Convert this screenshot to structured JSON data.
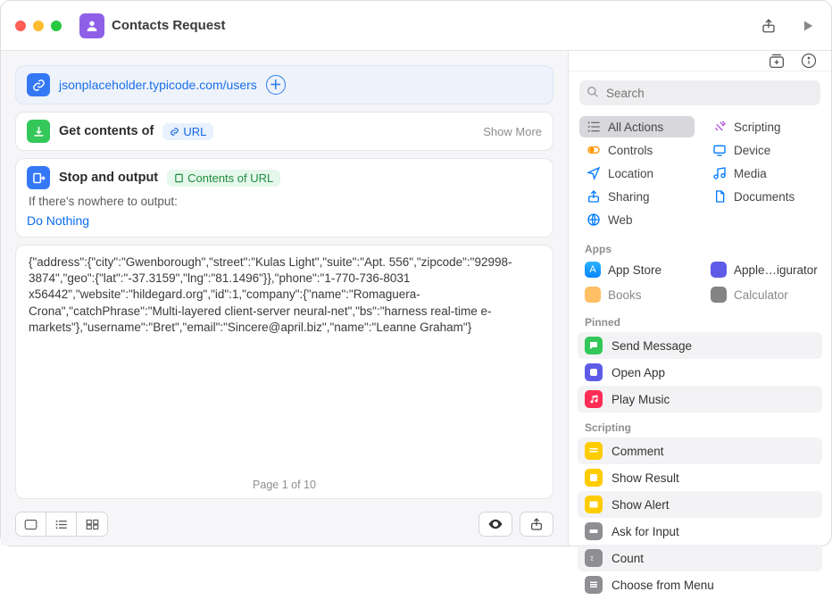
{
  "window": {
    "title": "Contacts Request"
  },
  "urlAction": {
    "url": "jsonplaceholder.typicode.com/users"
  },
  "getContents": {
    "title": "Get contents of",
    "token": "URL",
    "showMore": "Show More"
  },
  "stopOutput": {
    "title": "Stop and output",
    "token": "Contents of URL",
    "subLabel": "If there's nowhere to output:",
    "choice": "Do Nothing"
  },
  "output": {
    "text": "{\"address\":{\"city\":\"Gwenborough\",\"street\":\"Kulas Light\",\"suite\":\"Apt. 556\",\"zipcode\":\"92998-3874\",\"geo\":{\"lat\":\"-37.3159\",\"lng\":\"81.1496\"}},\"phone\":\"1-770-736-8031 x56442\",\"website\":\"hildegard.org\",\"id\":1,\"company\":{\"name\":\"Romaguera-Crona\",\"catchPhrase\":\"Multi-layered client-server neural-net\",\"bs\":\"harness real-time e-markets\"},\"username\":\"Bret\",\"email\":\"Sincere@april.biz\",\"name\":\"Leanne Graham\"}",
    "pageIndicator": "Page 1 of 10"
  },
  "sidebar": {
    "searchPlaceholder": "Search",
    "categories": {
      "allActions": "All Actions",
      "scripting": "Scripting",
      "controls": "Controls",
      "device": "Device",
      "location": "Location",
      "media": "Media",
      "sharing": "Sharing",
      "documents": "Documents",
      "web": "Web"
    },
    "sections": {
      "apps": "Apps",
      "pinned": "Pinned",
      "scripting": "Scripting"
    },
    "apps": {
      "appStore": "App Store",
      "configurator": "Apple…igurator",
      "books": "Books",
      "calculator": "Calculator"
    },
    "pinned": {
      "sendMessage": "Send Message",
      "openApp": "Open App",
      "playMusic": "Play Music"
    },
    "scriptingItems": {
      "comment": "Comment",
      "showResult": "Show Result",
      "showAlert": "Show Alert",
      "askInput": "Ask for Input",
      "count": "Count",
      "chooseMenu": "Choose from Menu"
    }
  }
}
